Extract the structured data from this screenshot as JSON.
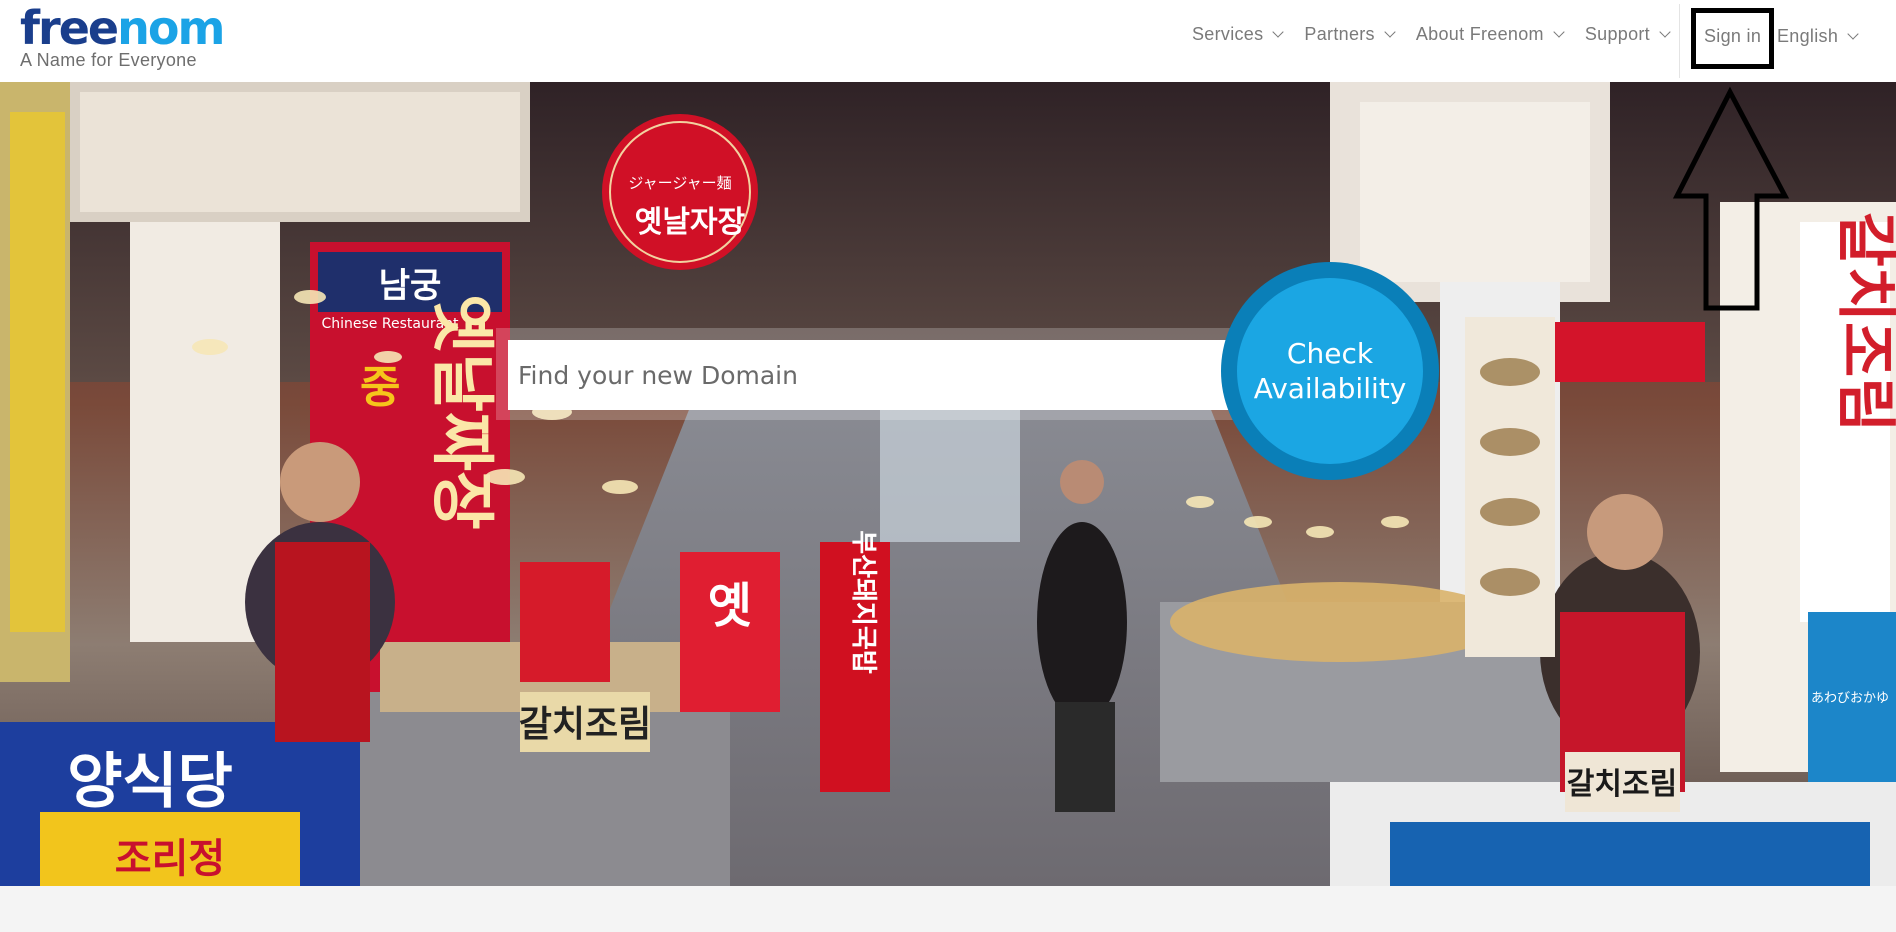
{
  "brand": {
    "logo_free": "free",
    "logo_nom": "nom",
    "tagline": "A Name for Everyone",
    "colors": {
      "dark_blue": "#1a3e8c",
      "light_blue": "#1ba3e6"
    }
  },
  "nav": {
    "items": [
      {
        "label": "Services"
      },
      {
        "label": "Partners"
      },
      {
        "label": "About Freenom"
      },
      {
        "label": "Support"
      }
    ],
    "signin_label": "Sign in",
    "language_label": "English"
  },
  "hero": {
    "search_placeholder": "Find your new Domain",
    "check_line1": "Check",
    "check_line2": "Availability",
    "sign_texts": {
      "red_round_jp": "ジャージャー麺",
      "red_round_kr": "옛날자장",
      "chinese_restaurant_kr": "남궁",
      "chinese_restaurant_en": "Chinese Restaurant",
      "left_red_sign": "옛날짜장",
      "left_red_sign_2": "중화요리",
      "left_small_sign": "갈치조림",
      "center_sign": "부산돼지국밥",
      "right_tall_sign": "갈치조림",
      "right_small_sign": "갈치조림",
      "bottom_left_sign": "양식당",
      "bottom_left_sign_2": "조리정",
      "right_menu_jp": "あわびおかゆ"
    }
  },
  "annotation": {
    "color": "#000000"
  }
}
